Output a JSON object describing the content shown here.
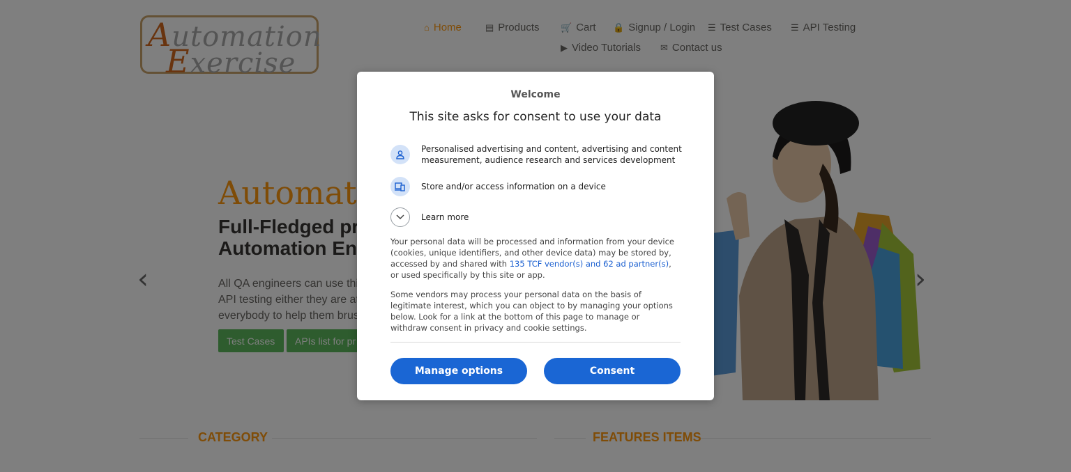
{
  "logo": {
    "line1_cap": "A",
    "line1_rest": "utomation",
    "line2_cap": "E",
    "line2_rest": "xercise"
  },
  "nav": {
    "items": [
      {
        "label": "Home",
        "icon": "home-icon",
        "active": true
      },
      {
        "label": "Products",
        "icon": "products-icon"
      },
      {
        "label": "Cart",
        "icon": "cart-icon"
      },
      {
        "label": "Signup / Login",
        "icon": "lock-icon"
      },
      {
        "label": "Test Cases",
        "icon": "list-icon"
      },
      {
        "label": "API Testing",
        "icon": "list-icon"
      },
      {
        "label": "Video Tutorials",
        "icon": "youtube-icon"
      },
      {
        "label": "Contact us",
        "icon": "envelope-icon"
      }
    ]
  },
  "hero": {
    "title": "Automatio",
    "subtitle_line1": "Full-Fledged pra",
    "subtitle_line2": "Automation Eng",
    "desc_line1": "All QA engineers can use thi",
    "desc_line2": "API testing either they are at",
    "desc_line3": "everybody to help them brus",
    "btn_test_cases": "Test Cases",
    "btn_apis": "APIs list for pr",
    "prev": "‹",
    "next": "›"
  },
  "sections": {
    "category": "CATEGORY",
    "features": "FEATURES ITEMS"
  },
  "dialog": {
    "welcome": "Welcome",
    "heading": "This site asks for consent to use your data",
    "purpose1": "Personalised advertising and content, advertising and content measurement, audience research and services development",
    "purpose2": "Store and/or access information on a device",
    "learn_more": "Learn more",
    "para1_before": "Your personal data will be processed and information from your device (cookies, unique identifiers, and other device data) may be stored by, accessed by and shared with ",
    "para1_link": "135 TCF vendor(s) and 62 ad partner(s)",
    "para1_after": ", or used specifically by this site or app.",
    "para2": "Some vendors may process your personal data on the basis of legitimate interest, which you can object to by managing your options below. Look for a link at the bottom of this page to manage or withdraw consent in privacy and cookie settings.",
    "manage_button": "Manage options",
    "consent_button": "Consent"
  },
  "colors": {
    "accent": "#fe980f",
    "primary_button": "#1a66d4",
    "green_button": "#5cb85c"
  }
}
